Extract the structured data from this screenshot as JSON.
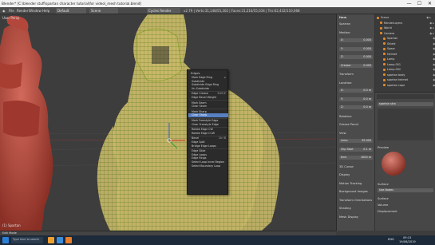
{
  "window": {
    "title": "Blender* [C:\\blender stuff\\spartan character tutorial\\for video\\_mesh tutorial.blend]",
    "minimize": "—",
    "maximize": "☐",
    "close": "✕"
  },
  "header": {
    "menus": [
      "File",
      "Render",
      "Window",
      "Help"
    ],
    "layout": "Default",
    "scene": "Scene",
    "engine": "Cycles Render",
    "stats": "v2.79 | Verts:31,148/55,302 | Faces:31,216/55,034 | Tris:62,432/110,068"
  },
  "viewport": {
    "top_left_label": "User Persp",
    "bottom_left_label": "(1) Spartan",
    "mode": "Edit Mode"
  },
  "context_menu": {
    "title": "Edges",
    "items": [
      {
        "label": "Mark Edge Ring",
        "shortcut": "▸"
      },
      {
        "label": "Subdivide",
        "shortcut": ""
      },
      {
        "label": "Subdivide Edge Ring",
        "shortcut": ""
      },
      {
        "label": "Un-Subdivide",
        "shortcut": ""
      },
      {
        "sep": true
      },
      {
        "label": "Edge Crease",
        "shortcut": "Shift E"
      },
      {
        "label": "Edge Bevel Weight",
        "shortcut": ""
      },
      {
        "sep": true
      },
      {
        "label": "Mark Seam",
        "shortcut": ""
      },
      {
        "label": "Clear Seam",
        "shortcut": ""
      },
      {
        "sep": true
      },
      {
        "label": "Mark Sharp",
        "shortcut": ""
      },
      {
        "label": "Clear Sharp",
        "shortcut": "",
        "active": true
      },
      {
        "sep": true
      },
      {
        "label": "Mark Freestyle Edge",
        "shortcut": ""
      },
      {
        "label": "Clear Freestyle Edge",
        "shortcut": ""
      },
      {
        "sep": true
      },
      {
        "label": "Rotate Edge CW",
        "shortcut": ""
      },
      {
        "label": "Rotate Edge CCW",
        "shortcut": ""
      },
      {
        "sep": true
      },
      {
        "label": "Bevel",
        "shortcut": "Ctrl B"
      },
      {
        "label": "Edge Split",
        "shortcut": ""
      },
      {
        "label": "Bridge Edge Loops",
        "shortcut": ""
      },
      {
        "sep": true
      },
      {
        "label": "Edge Slide",
        "shortcut": ""
      },
      {
        "label": "Edge Loops",
        "shortcut": ""
      },
      {
        "label": "Edge Rings",
        "shortcut": ""
      },
      {
        "label": "Select Loop Inner-Region",
        "shortcut": ""
      },
      {
        "label": "Select Boundary Loop",
        "shortcut": ""
      }
    ]
  },
  "properties": {
    "header": "Item",
    "rows": [
      {
        "label": "Spartan",
        "value": ""
      },
      {
        "label": "Median:",
        "value": ""
      },
      {
        "label": "X:",
        "value": "0.000"
      },
      {
        "label": "Y:",
        "value": "0.000"
      },
      {
        "label": "Z:",
        "value": "0.000"
      },
      {
        "label": "Crease:",
        "value": "0.000"
      },
      {
        "label": "Transform",
        "value": ""
      },
      {
        "label": "Location:",
        "value": ""
      },
      {
        "label": "X:",
        "value": "0.0 m"
      },
      {
        "label": "Y:",
        "value": "0.0 m"
      },
      {
        "label": "Z:",
        "value": "0.0 m"
      },
      {
        "label": "Rotation:",
        "value": ""
      },
      {
        "label": "Grease Pencil",
        "value": ""
      },
      {
        "label": "View",
        "value": ""
      },
      {
        "label": "Lens:",
        "value": "35.000"
      },
      {
        "label": "Clip Start",
        "value": "0.1 m"
      },
      {
        "label": "End:",
        "value": "1000 m"
      },
      {
        "label": "3D Cursor",
        "value": ""
      },
      {
        "label": "Display",
        "value": ""
      },
      {
        "label": "Motion Tracking",
        "value": ""
      },
      {
        "label": "Background Images",
        "value": ""
      },
      {
        "label": "Transform Orientations",
        "value": ""
      },
      {
        "label": "Shading",
        "value": ""
      },
      {
        "label": "Mesh Display",
        "value": ""
      }
    ]
  },
  "outliner": {
    "items": [
      "Scene",
      "RenderLayers",
      "World",
      "Camera",
      "Spartan",
      "Shield",
      "Spear",
      "Helmet",
      "Lamp",
      "Lamp.001",
      "Lamp.002",
      "spartan body",
      "spartan helmet",
      "spartan cape"
    ]
  },
  "material": {
    "slot_name": "spartan skin",
    "tabs": [
      "Surface",
      "Volume",
      "Displacement"
    ],
    "settings": [
      "Preview",
      "Surface",
      "Use Nodes"
    ]
  },
  "taskbar": {
    "search": "Type here to search",
    "time": "09:15",
    "date": "19/06/2019",
    "lang": "ENG"
  }
}
